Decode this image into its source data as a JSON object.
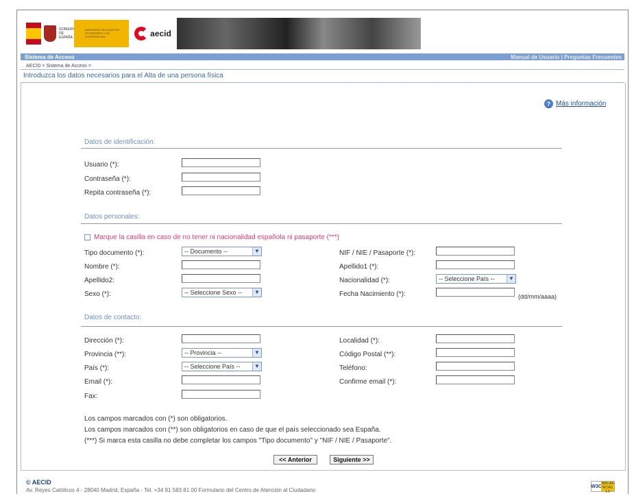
{
  "header": {
    "gobierno_text": "GOBIERNO DE ESPAÑA",
    "ministerio_text": "MINISTERIO DE ASUNTOS EXTERIORES Y DE COOPERACIÓN",
    "aecid_logo_text": "aecid"
  },
  "topbar": {
    "left": "Sistema de Acceso",
    "right": "Manual de Usuario  |  Preguntas Frecuentes"
  },
  "breadcrumb": "AECID > Sistema de Acceso >",
  "page_title": "Introduzca los datos necesarios para el Alta de una persona física",
  "more_info": "Más información",
  "sections": {
    "identificacion": "Datos de identificación:",
    "personales": "Datos personales:",
    "contacto": "Datos de contacto:"
  },
  "fields": {
    "usuario": "Usuario (*):",
    "contrasena": "Contraseña (*):",
    "repita": "Repita contraseña (*):",
    "checkbox_text": "Marque la casilla en caso de no tener ni nacionalidad española ni pasaporte (***)",
    "tipo_doc": "Tipo documento (*):",
    "tipo_doc_value": "-- Documento --",
    "nif": "NIF / NIE / Pasaporte (*):",
    "nombre": "Nombre (*):",
    "apellido1": "Apellido1 (*):",
    "apellido2": "Apellido2:",
    "nacionalidad": "Nacionalidad (*):",
    "nacionalidad_value": "-- Seleccione País --",
    "sexo": "Sexo (*):",
    "sexo_value": "-- Seleccione Sexo --",
    "fecha": "Fecha Nacimiento (*):",
    "fecha_hint": "(dd/mm/aaaa)",
    "direccion": "Dirección (*):",
    "localidad": "Localidad (*):",
    "provincia": "Provincia (**):",
    "provincia_value": "-- Provincia --",
    "cp": "Código Postal (**):",
    "pais": "País (*):",
    "pais_value": "-- Seleccione País --",
    "telefono": "Teléfono:",
    "email": "Email (*):",
    "confirme_email": "Confirme email (*):",
    "fax": "Fax:"
  },
  "notes": [
    "Los campos marcados con (*) son obligatorios.",
    "Los campos marcados con (**) son obligatorios en caso de que el país seleccionado sea España.",
    "(***) Si marca esta casilla no debe completar los campos \"Tipo documento\" y \"NIF / NIE / Pasaporte\"."
  ],
  "buttons": {
    "anterior": "<< Anterior",
    "siguiente": "Siguiente >>"
  },
  "footer": {
    "org": "© AECID",
    "address": "Av. Reyes Católicos 4 - 28040 Madrid, España - Tel. +34 91 583 81 00 Formulario del Centro de Atención al Ciudadano",
    "badge_w3c": "W3C",
    "badge_waa": "WAI-AA WCAG 1.0"
  }
}
